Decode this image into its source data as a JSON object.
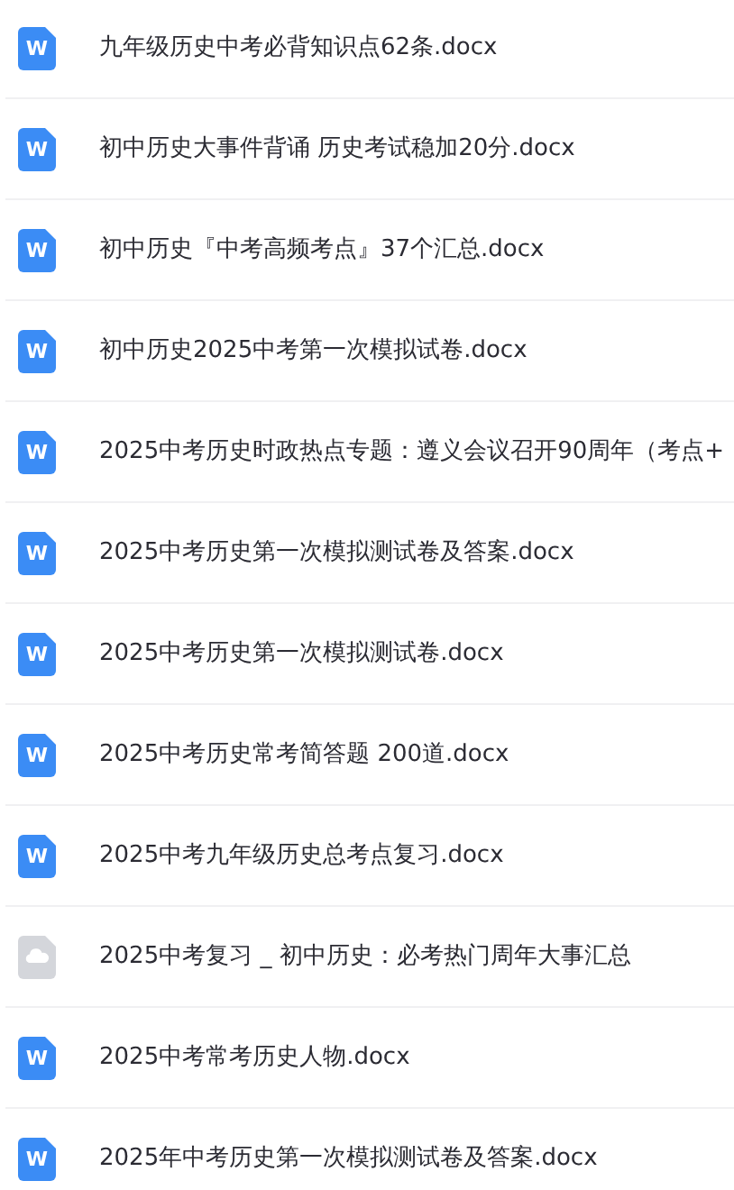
{
  "files": [
    {
      "kind": "word",
      "icon_label": "W",
      "name": "九年级历史中考必背知识点62条.docx"
    },
    {
      "kind": "word",
      "icon_label": "W",
      "name": "初中历史大事件背诵 历史考试稳加20分.docx"
    },
    {
      "kind": "word",
      "icon_label": "W",
      "name": "初中历史『中考高频考点』37个汇总.docx"
    },
    {
      "kind": "word",
      "icon_label": "W",
      "name": "初中历史2025中考第一次模拟试卷.docx"
    },
    {
      "kind": "word",
      "icon_label": "W",
      "name": "2025中考历史时政热点专题：遵义会议召开90周年（考点+"
    },
    {
      "kind": "word",
      "icon_label": "W",
      "name": "2025中考历史第一次模拟测试卷及答案.docx"
    },
    {
      "kind": "word",
      "icon_label": "W",
      "name": "2025中考历史第一次模拟测试卷.docx"
    },
    {
      "kind": "word",
      "icon_label": "W",
      "name": "2025中考历史常考简答题 200道.docx"
    },
    {
      "kind": "word",
      "icon_label": "W",
      "name": "2025中考九年级历史总考点复习.docx"
    },
    {
      "kind": "cloud",
      "name": "2025中考复习 _ 初中历史：必考热门周年大事汇总"
    },
    {
      "kind": "word",
      "icon_label": "W",
      "name": "2025中考常考历史人物.docx"
    },
    {
      "kind": "word",
      "icon_label": "W",
      "name": "2025年中考历史第一次模拟测试卷及答案.docx"
    }
  ]
}
